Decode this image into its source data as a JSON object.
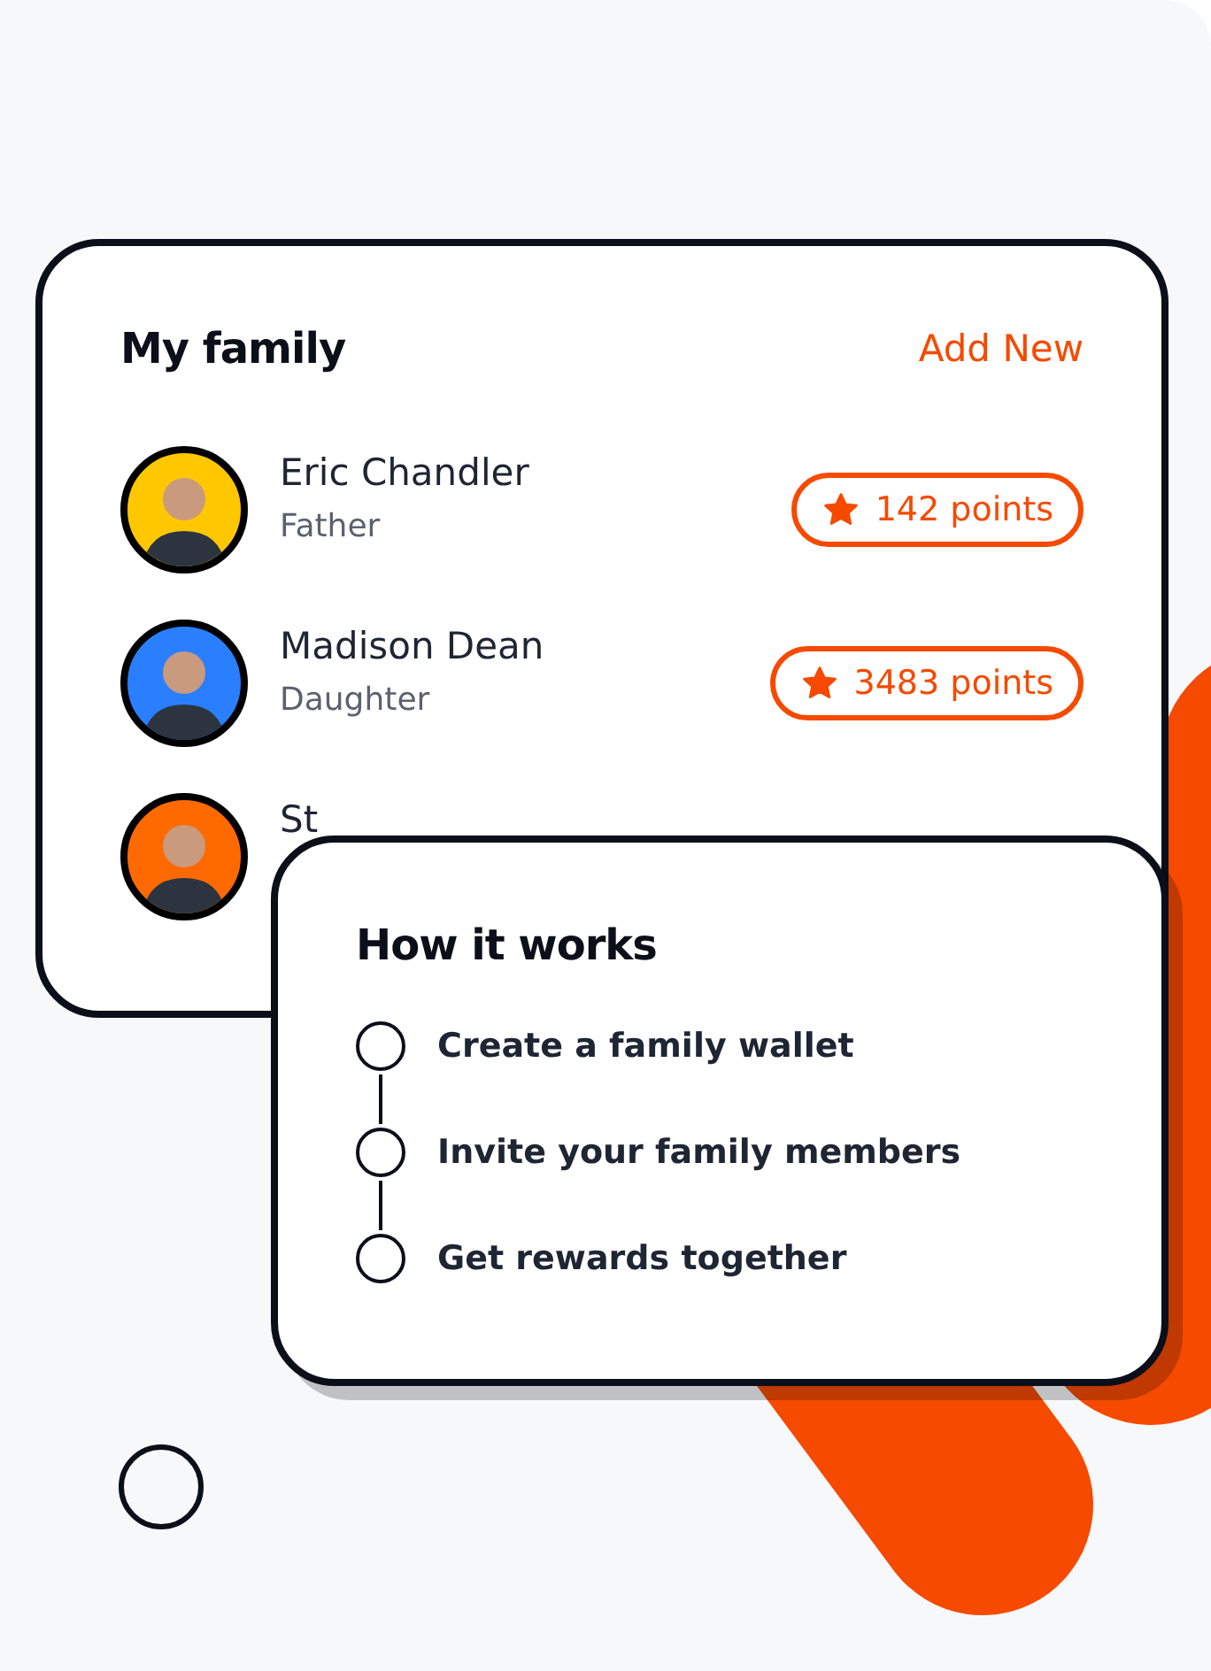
{
  "family_card": {
    "title": "My family",
    "action": "Add New",
    "members": [
      {
        "name": "Eric Chandler",
        "role": "Father",
        "points": "142 points",
        "color": "#ffc700"
      },
      {
        "name": "Madison Dean",
        "role": "Daughter",
        "points": "3483 points",
        "color": "#2a7fff"
      },
      {
        "name": "St",
        "color": "#ff6a00"
      }
    ]
  },
  "how_it_works": {
    "title": "How it works",
    "steps": [
      "Create a family wallet",
      "Invite your family members",
      "Get rewards together"
    ]
  }
}
